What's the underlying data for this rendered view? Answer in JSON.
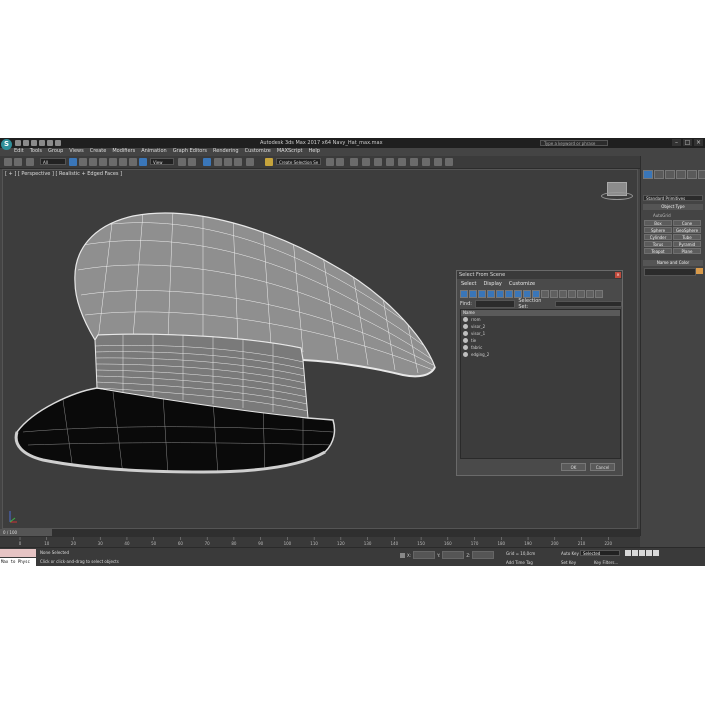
{
  "window": {
    "title": "Autodesk 3ds Max 2017 x64    Navy_Hat_max.max",
    "search_placeholder": "Type a keyword or phrase"
  },
  "menu": [
    "Edit",
    "Tools",
    "Group",
    "Views",
    "Create",
    "Modifiers",
    "Animation",
    "Graph Editors",
    "Rendering",
    "Customize",
    "MAXScript",
    "Help"
  ],
  "toolbar": {
    "filter_dropdown": "All",
    "refcoord_dropdown": "View",
    "selection_set": "Create Selection Se"
  },
  "viewport": {
    "label": "[ + ] [ Perspective ] [ Realistic + Edged Faces ]"
  },
  "dialog": {
    "title": "Select From Scene",
    "tabs": [
      "Select",
      "Display",
      "Customize"
    ],
    "find_label": "Find:",
    "selection_set_label": "Selection Set:",
    "list_header": "Name",
    "items": [
      "rrom",
      "visor_2",
      "visor_1",
      "tie",
      "fabric",
      "edging_2"
    ],
    "ok": "OK",
    "cancel": "Cancel"
  },
  "command_panel": {
    "dropdown": "Standard Primitives",
    "object_type_header": "Object Type",
    "autogrid": "AutoGrid",
    "primitives": [
      "Box",
      "Cone",
      "Sphere",
      "GeoSphere",
      "Cylinder",
      "Tube",
      "Torus",
      "Pyramid",
      "Teapot",
      "Plane"
    ],
    "name_color_header": "Name and Color"
  },
  "timeline": {
    "frame_label": "0 / 100",
    "ticks": [
      "0",
      "10",
      "20",
      "30",
      "40",
      "50",
      "60",
      "70",
      "80",
      "90",
      "100",
      "110",
      "120",
      "130",
      "140",
      "150",
      "160",
      "170",
      "180",
      "190",
      "200",
      "210",
      "220"
    ]
  },
  "status": {
    "maxscript": "Max to Physc",
    "none_selected": "None Selected",
    "prompt": "Click or click-and-drag to select objects",
    "x_label": "X:",
    "y_label": "Y:",
    "z_label": "Z:",
    "grid": "Grid = 10,0cm",
    "add_time_tag": "Add Time Tag",
    "auto_key": "Auto Key",
    "selected": "Selected",
    "set_key": "Set Key",
    "key_filters": "Key Filters..."
  }
}
